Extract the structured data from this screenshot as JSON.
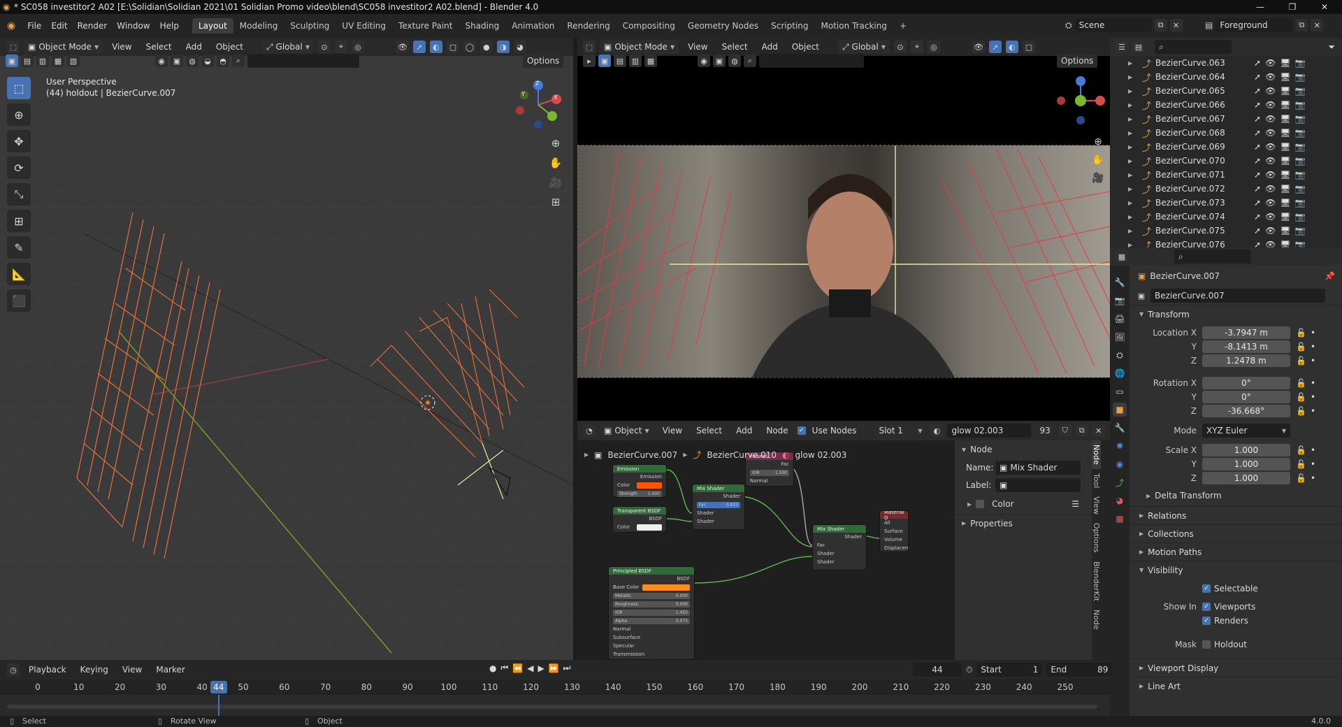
{
  "window": {
    "title": "* SC058 investitor2 A02 [E:\\Solidian\\Solidian 2021\\01 Solidian Promo video\\blend\\SC058 investitor2 A02.blend] - Blender 4.0",
    "minimize": "—",
    "maximize": "❐",
    "close": "✕"
  },
  "menu": [
    "File",
    "Edit",
    "Render",
    "Window",
    "Help"
  ],
  "workspaces": [
    "Layout",
    "Modeling",
    "Sculpting",
    "UV Editing",
    "Texture Paint",
    "Shading",
    "Animation",
    "Rendering",
    "Compositing",
    "Geometry Nodes",
    "Scripting",
    "Motion Tracking"
  ],
  "add_workspace": "+",
  "scene": {
    "name": "Scene",
    "view_layer": "Foreground"
  },
  "viewport": {
    "mode": "Object Mode",
    "menus": [
      "View",
      "Select",
      "Add",
      "Object"
    ],
    "orientation": "Global",
    "options": "Options",
    "perspective_label": "User Perspective",
    "object_label": "(44) holdout | BezierCurve.007",
    "gizmo": {
      "x": "X",
      "y": "Y",
      "z": "Z"
    }
  },
  "camera_view": {
    "mode": "Object Mode",
    "menus": [
      "View",
      "Select",
      "Add",
      "Object"
    ],
    "orientation": "Global",
    "options": "Options"
  },
  "node_editor": {
    "type": "Object",
    "menus": [
      "View",
      "Select",
      "Add",
      "Node"
    ],
    "use_nodes": "Use Nodes",
    "slot": "Slot 1",
    "material": "glow 02.003",
    "users": "93",
    "breadcrumb": [
      "BezierCurve.007",
      "BezierCurve.010",
      "glow 02.003"
    ],
    "nodes": {
      "emission": {
        "title": "Emission",
        "out": "Emission",
        "color": "Color",
        "strength": "Strength",
        "strength_val": "1.000"
      },
      "transparent": {
        "title": "Transparent BSDF",
        "out": "BSDF",
        "color": "Color"
      },
      "mix1": {
        "title": "Mix Shader",
        "out": "Shader",
        "fac": "Fac",
        "fac_val": "0.833",
        "s1": "Shader",
        "s2": "Shader"
      },
      "fresnel": {
        "title": "Fresnel",
        "fac": "Fac",
        "ior": "IOR",
        "ior_val": "1.500",
        "normal": "Normal"
      },
      "mix2": {
        "title": "Mix Shader",
        "out": "Shader",
        "fac": "Fac",
        "s1": "Shader",
        "s2": "Shader"
      },
      "output": {
        "title": "Material O",
        "all": "All",
        "surface": "Surface",
        "volume": "Volume",
        "disp": "Displacemen"
      },
      "principled": {
        "title": "Principled BSDF",
        "out": "BSDF",
        "base_color": "Base Color",
        "metallic": "Metallic",
        "metallic_val": "0.000",
        "roughness": "Roughness",
        "roughness_val": "0.000",
        "ior": "IOR",
        "ior_val": "1.450",
        "alpha": "Alpha",
        "alpha_val": "0.073",
        "normal": "Normal",
        "subsurface": "Subsurface",
        "specular": "Specular",
        "transmission": "Transmission"
      }
    },
    "sidebar": {
      "header": "Node",
      "name_label": "Name:",
      "name_val": "Mix Shader",
      "label_label": "Label:",
      "label_val": "",
      "color": "Color",
      "properties": "Properties"
    },
    "tabs": [
      "Node",
      "Tool",
      "View",
      "Options",
      "BlenderKit",
      "Node"
    ]
  },
  "outliner": {
    "items": [
      "BezierCurve.063",
      "BezierCurve.064",
      "BezierCurve.065",
      "BezierCurve.066",
      "BezierCurve.067",
      "BezierCurve.068",
      "BezierCurve.069",
      "BezierCurve.070",
      "BezierCurve.071",
      "BezierCurve.072",
      "BezierCurve.073",
      "BezierCurve.074",
      "BezierCurve.075",
      "BezierCurve.076"
    ]
  },
  "properties": {
    "object_name": "BezierCurve.007",
    "datablock": "BezierCurve.007",
    "transform": "Transform",
    "location_x_label": "Location X",
    "location_x": "-3.7947 m",
    "location_y_label": "Y",
    "location_y": "-8.1413 m",
    "location_z_label": "Z",
    "location_z": "1.2478 m",
    "rotation_x_label": "Rotation X",
    "rotation_x": "0°",
    "rotation_y_label": "Y",
    "rotation_y": "0°",
    "rotation_z_label": "Z",
    "rotation_z": "-36.668°",
    "mode_label": "Mode",
    "mode": "XYZ Euler",
    "scale_x_label": "Scale X",
    "scale_x": "1.000",
    "scale_y_label": "Y",
    "scale_y": "1.000",
    "scale_z_label": "Z",
    "scale_z": "1.000",
    "delta_transform": "Delta Transform",
    "sections": [
      "Relations",
      "Collections",
      "Motion Paths"
    ],
    "visibility": "Visibility",
    "selectable": "Selectable",
    "show_in": "Show In",
    "viewports": "Viewports",
    "renders": "Renders",
    "mask": "Mask",
    "holdout": "Holdout",
    "viewport_display": "Viewport Display",
    "line_art": "Line Art"
  },
  "timeline": {
    "menus": [
      "Playback",
      "Keying",
      "View",
      "Marker"
    ],
    "current_frame": "44",
    "start_label": "Start",
    "start": "1",
    "end_label": "End",
    "end": "89",
    "ticks": [
      "0",
      "10",
      "20",
      "30",
      "40",
      "50",
      "60",
      "70",
      "80",
      "90",
      "100",
      "110",
      "120",
      "130",
      "140",
      "150",
      "160",
      "170",
      "180",
      "190",
      "200",
      "210",
      "220",
      "230",
      "240",
      "250"
    ]
  },
  "status": {
    "select": "Select",
    "rotate": "Rotate View",
    "object": "Object",
    "version": "4.0.0"
  },
  "colors": {
    "accent": "#4772b3",
    "selected_curve": "#e8713a",
    "emission": "#ff5500",
    "base_color": "#ff8c1a",
    "node_header_green": "#2f6b36"
  }
}
